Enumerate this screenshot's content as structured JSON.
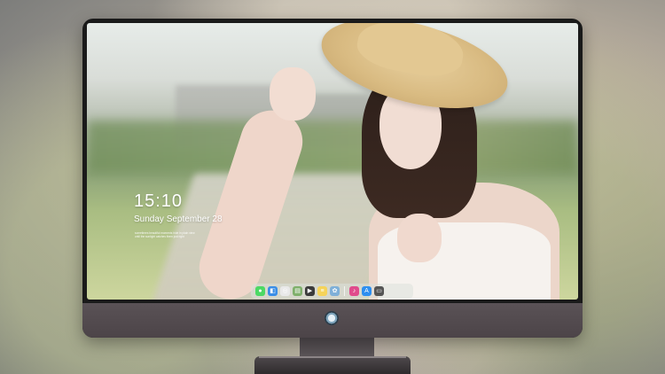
{
  "lockscreen": {
    "time": "15:10",
    "date": "Sunday September 28",
    "notes": [
      "sometimes beautiful moments hide in plain view",
      "until the sunlight catches them just right"
    ]
  },
  "dock": {
    "items": [
      {
        "name": "messages-icon",
        "glyph": "●",
        "color": "#4cd964"
      },
      {
        "name": "finder-icon",
        "glyph": "◧",
        "color": "#3a8ee6"
      },
      {
        "name": "safari-icon",
        "glyph": "◎",
        "color": "#e9e9e9"
      },
      {
        "name": "preview-icon",
        "glyph": "▤",
        "color": "#7fb06b"
      },
      {
        "name": "video-icon",
        "glyph": "▶",
        "color": "#3b3b3b"
      },
      {
        "name": "notes-icon",
        "glyph": "≡",
        "color": "#f5d35a"
      },
      {
        "name": "photos-icon",
        "glyph": "✿",
        "color": "#7fb0d8"
      },
      {
        "name": "music-icon",
        "glyph": "♪",
        "color": "#e04b8c"
      },
      {
        "name": "appstore-icon",
        "glyph": "A",
        "color": "#2d8ff0"
      },
      {
        "name": "folder-icon",
        "glyph": "▭",
        "color": "#555555"
      }
    ]
  },
  "colors": {
    "bezel": "#1a1a1a",
    "chin": "#514a4e"
  }
}
